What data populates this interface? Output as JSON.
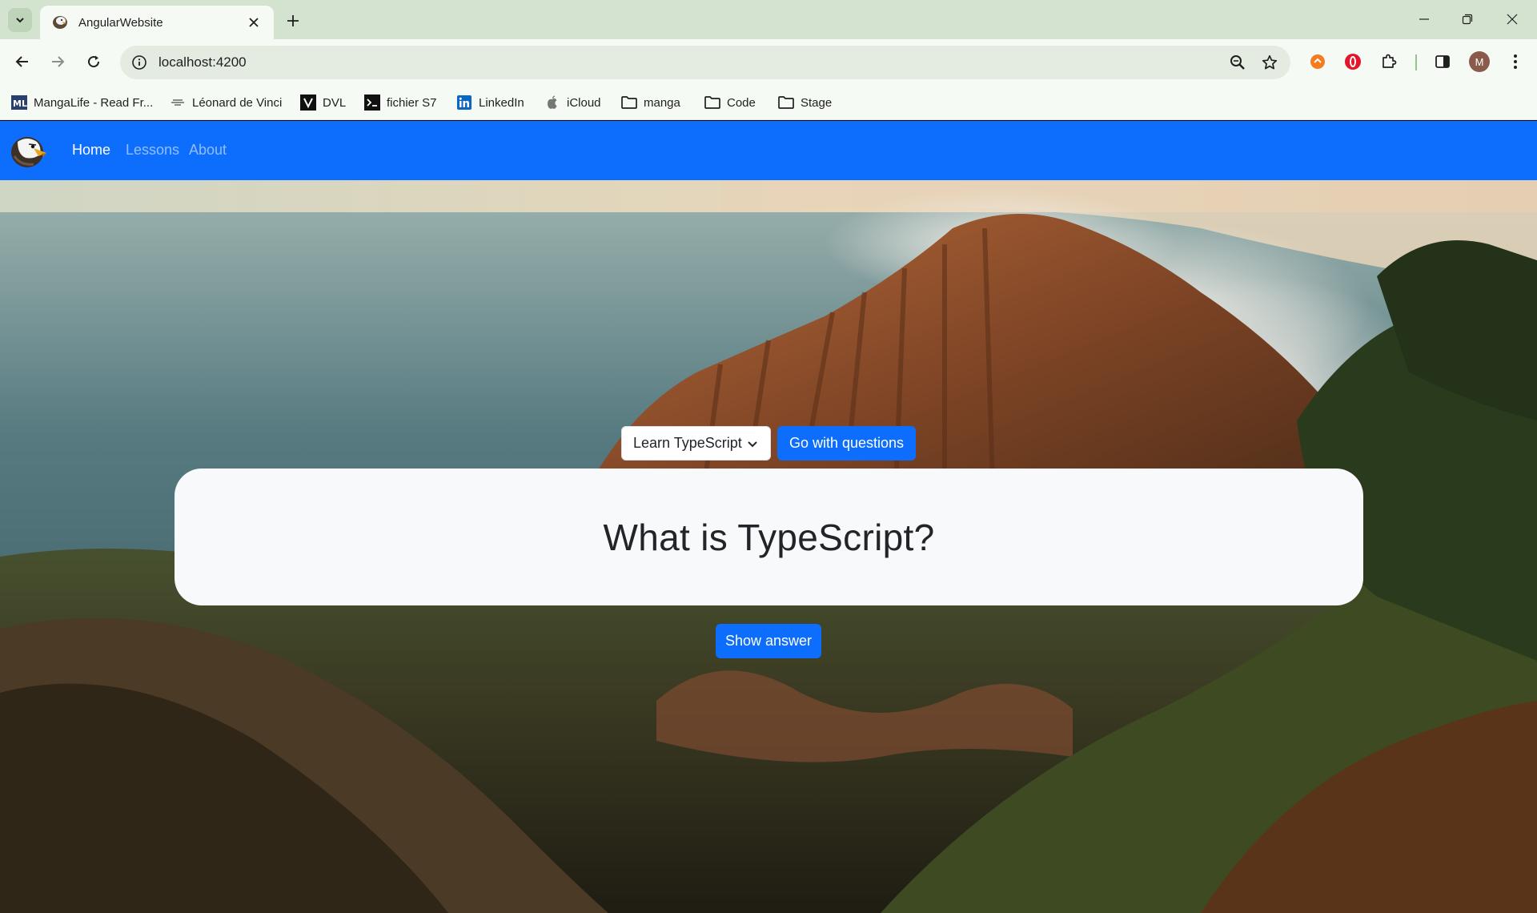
{
  "browser": {
    "tab": {
      "title": "AngularWebsite",
      "favicon": "eagle-icon"
    },
    "address": {
      "url": "localhost:4200"
    },
    "profile_initial": "M",
    "bookmarks": [
      {
        "label": "MangaLife - Read Fr...",
        "icon": "mangalife-icon"
      },
      {
        "label": "Léonard de Vinci",
        "icon": "devinci-icon"
      },
      {
        "label": "DVL",
        "icon": "dvl-icon"
      },
      {
        "label": "fichier S7",
        "icon": "terminal-icon"
      },
      {
        "label": "LinkedIn",
        "icon": "linkedin-icon"
      },
      {
        "label": "iCloud",
        "icon": "apple-icon"
      },
      {
        "label": "manga",
        "icon": "folder-icon"
      },
      {
        "label": "Code",
        "icon": "folder-icon"
      },
      {
        "label": "Stage",
        "icon": "folder-icon"
      }
    ]
  },
  "navbar": {
    "brand_icon": "eagle-logo",
    "links": [
      {
        "label": "Home",
        "active": true
      },
      {
        "label": "Lessons",
        "active": false
      },
      {
        "label": "About",
        "active": false
      }
    ],
    "color": "#0d6efd"
  },
  "main": {
    "select_label": "Learn TypeScript",
    "go_button": "Go with questions",
    "question": "What is TypeScript?",
    "answer_button": "Show answer"
  }
}
